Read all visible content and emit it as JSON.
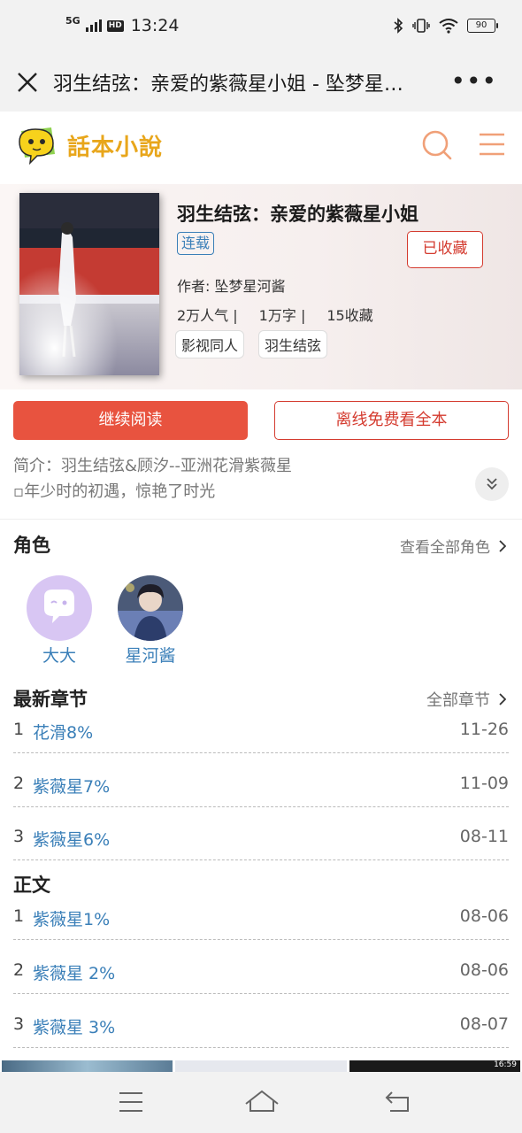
{
  "status": {
    "network": "5G",
    "hd": "HD",
    "time": "13:24",
    "battery": "90"
  },
  "titlebar": {
    "title": "羽生结弦：亲爱的紫薇星小姐 - 坠梦星…"
  },
  "site": {
    "logo_text": "話本小說"
  },
  "book": {
    "title": "羽生结弦：亲爱的紫薇星小姐",
    "status_tag": "连载",
    "collected_label": "已收藏",
    "author": "作者: 坠梦星河酱",
    "stats": [
      "2万人气 |",
      "1万字 |",
      "15收藏"
    ],
    "tags": [
      "影视同人",
      "羽生结弦"
    ]
  },
  "actions": {
    "continue_label": "继续阅读",
    "offline_label": "离线免费看全本"
  },
  "intro": {
    "line1": "简介：羽生结弦&顾汐--亚洲花滑紫薇星",
    "line2": "▫年少时的初遇，惊艳了时光"
  },
  "roles": {
    "title": "角色",
    "link": "查看全部角色",
    "items": [
      {
        "name": "大大"
      },
      {
        "name": "星河酱"
      }
    ]
  },
  "latest": {
    "title": "最新章节",
    "link": "全部章节",
    "chapters": [
      {
        "num": "1",
        "name": "花滑8%",
        "date": "11-26"
      },
      {
        "num": "2",
        "name": "紫薇星7%",
        "date": "11-09"
      },
      {
        "num": "3",
        "name": "紫薇星6%",
        "date": "08-11"
      }
    ]
  },
  "body_chapters": {
    "title": "正文",
    "chapters": [
      {
        "num": "1",
        "name": "紫薇星1%",
        "date": "08-06"
      },
      {
        "num": "2",
        "name": "紫薇星 2%",
        "date": "08-06"
      },
      {
        "num": "3",
        "name": "紫薇星 3%",
        "date": "08-07"
      }
    ]
  },
  "thumb_clock": "16:59",
  "colors": {
    "accent_red": "#e8533f",
    "link_blue": "#3a7fb8",
    "logo_orange": "#e8a61b"
  }
}
